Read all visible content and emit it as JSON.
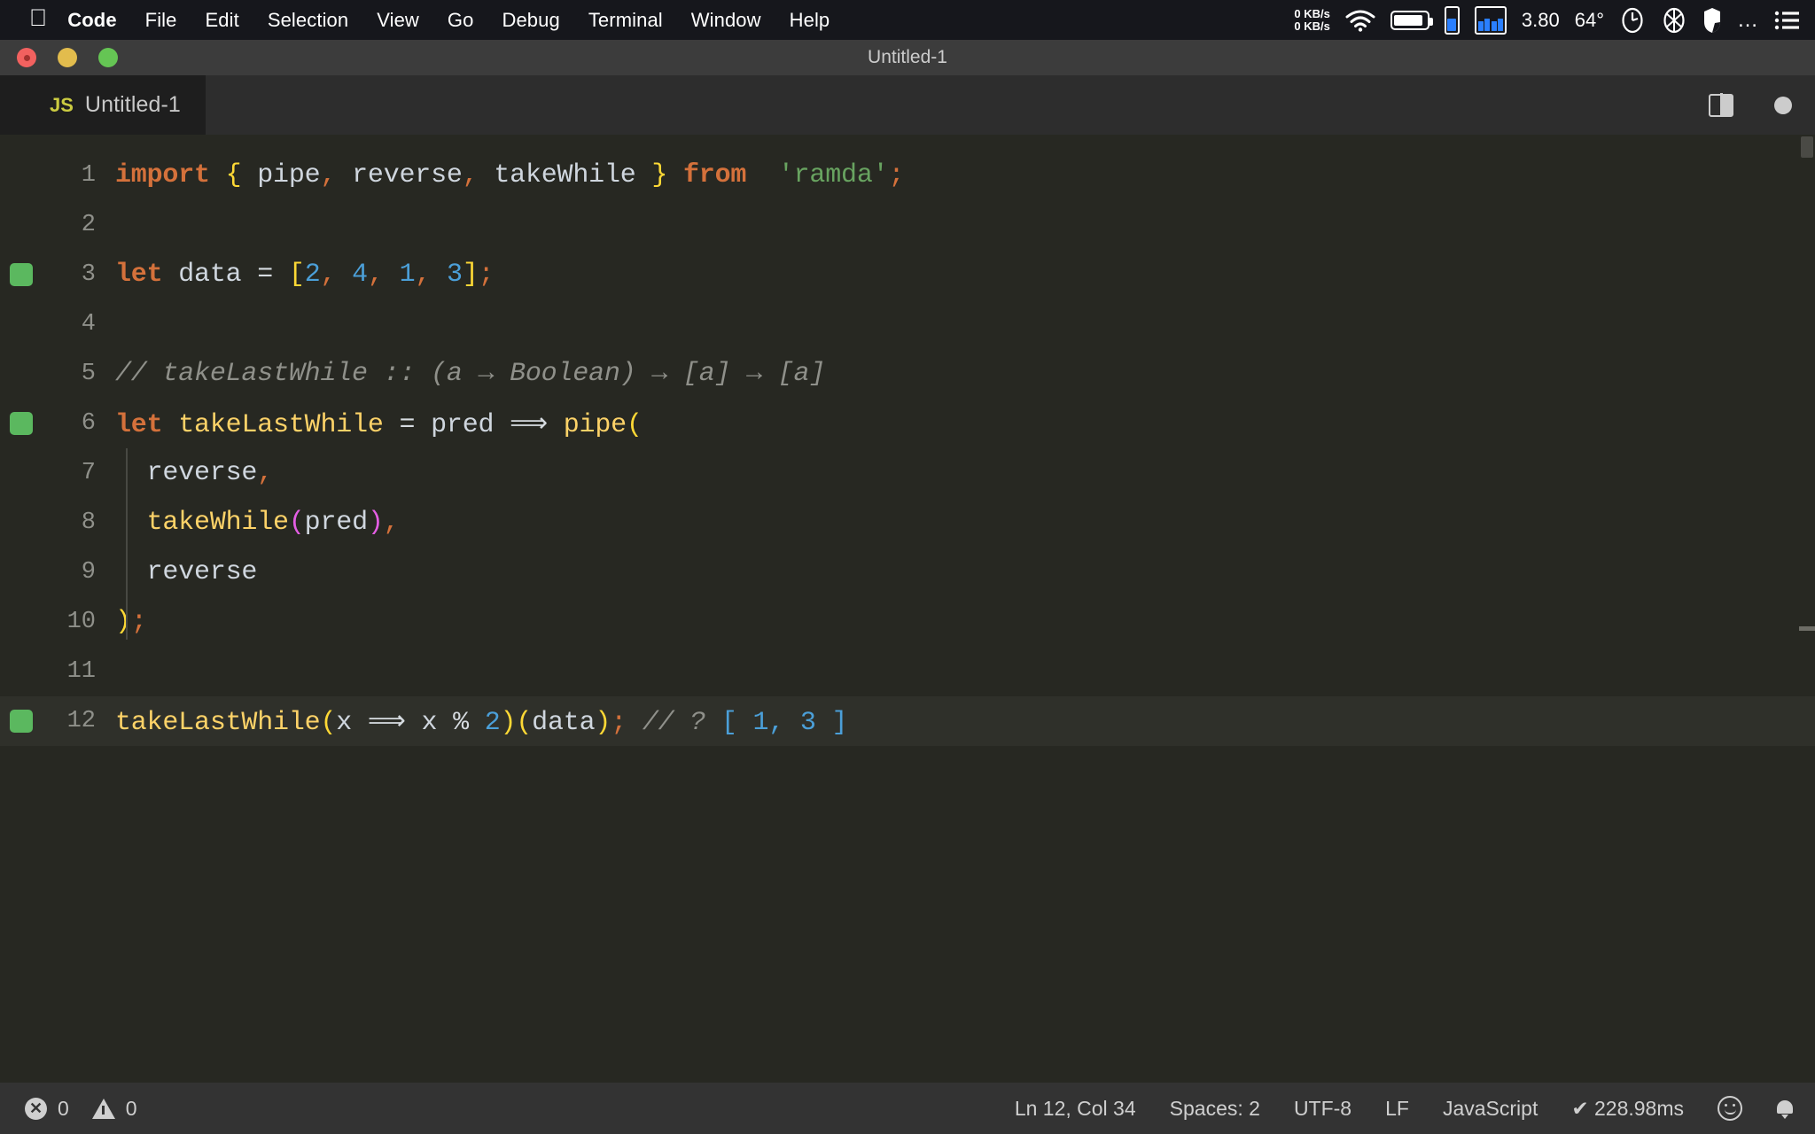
{
  "menubar": {
    "apple_glyph": "apple-logo-icon",
    "items": [
      {
        "label": "Code",
        "bold": true
      },
      {
        "label": "File",
        "bold": false
      },
      {
        "label": "Edit",
        "bold": false
      },
      {
        "label": "Selection",
        "bold": false
      },
      {
        "label": "View",
        "bold": false
      },
      {
        "label": "Go",
        "bold": false
      },
      {
        "label": "Debug",
        "bold": false
      },
      {
        "label": "Terminal",
        "bold": false
      },
      {
        "label": "Window",
        "bold": false
      },
      {
        "label": "Help",
        "bold": false
      }
    ],
    "status": {
      "net_up": "0 KB/s",
      "net_down": "0 KB/s",
      "wifi_icon": "wifi-icon",
      "battery_icon": "battery-icon",
      "memory_meter_icon": "memory-meter-icon",
      "cpu_graph_icon": "cpu-history-graph-icon",
      "load_average": "3.80",
      "temperature": "64°",
      "clock_icon": "analog-clock-icon",
      "aperture_icon": "aperture-icon",
      "shield_icon": "shield-icon",
      "more_icon": "ellipsis-icon",
      "list_icon": "control-center-list-icon"
    }
  },
  "window": {
    "title": "Untitled-1",
    "traffic_lights": [
      "close-button",
      "minimize-button",
      "maximize-button"
    ],
    "accent_colors": {
      "close": "#f2615f",
      "minimize": "#e2bc4d",
      "maximize": "#65c554"
    }
  },
  "tabstrip": {
    "active_tab": {
      "file_type_badge": "JS",
      "label": "Untitled-1"
    },
    "actions": {
      "split_editor_icon": "split-editor-right-icon",
      "unsaved_dot_icon": "unsaved-changes-dot-icon"
    }
  },
  "editor": {
    "indent_guide_color": "#484943",
    "current_line": 12,
    "breakpoint_lines": [
      3,
      6,
      12
    ],
    "lines": [
      {
        "n": 1,
        "tokens": [
          {
            "t": "import",
            "c": "t-kw"
          },
          {
            "t": " ",
            "c": "t-op"
          },
          {
            "t": "{",
            "c": "t-brace"
          },
          {
            "t": " pipe",
            "c": "t-ident"
          },
          {
            "t": ",",
            "c": "t-punc"
          },
          {
            "t": " reverse",
            "c": "t-ident"
          },
          {
            "t": ",",
            "c": "t-punc"
          },
          {
            "t": " takeWhile ",
            "c": "t-ident"
          },
          {
            "t": "}",
            "c": "t-brace"
          },
          {
            "t": " ",
            "c": "t-op"
          },
          {
            "t": "from",
            "c": "t-kw"
          },
          {
            "t": "  ",
            "c": "t-op"
          },
          {
            "t": "'ramda'",
            "c": "t-str"
          },
          {
            "t": ";",
            "c": "t-punc"
          }
        ]
      },
      {
        "n": 2,
        "tokens": []
      },
      {
        "n": 3,
        "tokens": [
          {
            "t": "let",
            "c": "t-kw"
          },
          {
            "t": " data ",
            "c": "t-ident"
          },
          {
            "t": "=",
            "c": "t-op"
          },
          {
            "t": " ",
            "c": "t-op"
          },
          {
            "t": "[",
            "c": "t-yellow"
          },
          {
            "t": "2",
            "c": "t-num"
          },
          {
            "t": ",",
            "c": "t-punc"
          },
          {
            "t": " ",
            "c": "t-op"
          },
          {
            "t": "4",
            "c": "t-num"
          },
          {
            "t": ",",
            "c": "t-punc"
          },
          {
            "t": " ",
            "c": "t-op"
          },
          {
            "t": "1",
            "c": "t-num"
          },
          {
            "t": ",",
            "c": "t-punc"
          },
          {
            "t": " ",
            "c": "t-op"
          },
          {
            "t": "3",
            "c": "t-num"
          },
          {
            "t": "]",
            "c": "t-yellow"
          },
          {
            "t": ";",
            "c": "t-punc"
          }
        ]
      },
      {
        "n": 4,
        "tokens": []
      },
      {
        "n": 5,
        "tokens": [
          {
            "t": "// takeLastWhile :: (a → Boolean) → [a] → [a]",
            "c": "t-comment"
          }
        ]
      },
      {
        "n": 6,
        "tokens": [
          {
            "t": "let",
            "c": "t-kw"
          },
          {
            "t": " ",
            "c": "t-op"
          },
          {
            "t": "takeLastWhile",
            "c": "t-fn"
          },
          {
            "t": " ",
            "c": "t-op"
          },
          {
            "t": "=",
            "c": "t-op"
          },
          {
            "t": " pred",
            "c": "t-ident"
          },
          {
            "t": " ⟹ ",
            "c": "t-arrow"
          },
          {
            "t": "pipe",
            "c": "t-fn"
          },
          {
            "t": "(",
            "c": "t-yellow"
          }
        ]
      },
      {
        "n": 7,
        "tokens": [
          {
            "t": "  reverse",
            "c": "t-ident"
          },
          {
            "t": ",",
            "c": "t-punc"
          }
        ]
      },
      {
        "n": 8,
        "tokens": [
          {
            "t": "  ",
            "c": "t-op"
          },
          {
            "t": "takeWhile",
            "c": "t-fn"
          },
          {
            "t": "(",
            "c": "t-paren-m"
          },
          {
            "t": "pred",
            "c": "t-ident"
          },
          {
            "t": ")",
            "c": "t-paren-m"
          },
          {
            "t": ",",
            "c": "t-punc"
          }
        ]
      },
      {
        "n": 9,
        "tokens": [
          {
            "t": "  reverse",
            "c": "t-ident"
          }
        ]
      },
      {
        "n": 10,
        "tokens": [
          {
            "t": ")",
            "c": "t-yellow"
          },
          {
            "t": ";",
            "c": "t-punc"
          }
        ]
      },
      {
        "n": 11,
        "tokens": []
      },
      {
        "n": 12,
        "tokens": [
          {
            "t": "takeLastWhile",
            "c": "t-fn"
          },
          {
            "t": "(",
            "c": "t-yellow"
          },
          {
            "t": "x",
            "c": "t-ident"
          },
          {
            "t": " ⟹ ",
            "c": "t-arrow"
          },
          {
            "t": "x ",
            "c": "t-ident"
          },
          {
            "t": "%",
            "c": "t-op"
          },
          {
            "t": " ",
            "c": "t-op"
          },
          {
            "t": "2",
            "c": "t-num"
          },
          {
            "t": ")",
            "c": "t-yellow"
          },
          {
            "t": "(",
            "c": "t-yellow"
          },
          {
            "t": "data",
            "c": "t-ident"
          },
          {
            "t": ")",
            "c": "t-yellow"
          },
          {
            "t": ";",
            "c": "t-punc"
          },
          {
            "t": " // ? ",
            "c": "t-comment"
          },
          {
            "t": "[ 1, 3 ]",
            "c": "t-num"
          }
        ]
      }
    ]
  },
  "statusbar": {
    "errors": "0",
    "warnings": "0",
    "cursor_position": "Ln 12, Col 34",
    "indentation": "Spaces: 2",
    "encoding": "UTF-8",
    "eol": "LF",
    "language": "JavaScript",
    "run_time": "✔ 228.98ms",
    "feedback_icon": "smiley-feedback-icon",
    "notifications_icon": "bell-notifications-icon"
  }
}
